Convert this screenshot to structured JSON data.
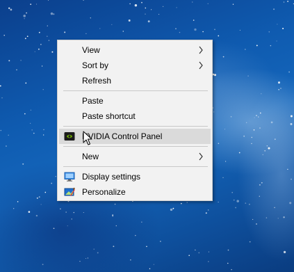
{
  "context_menu": {
    "items": [
      {
        "label": "View",
        "submenu": true
      },
      {
        "label": "Sort by",
        "submenu": true
      },
      {
        "label": "Refresh"
      },
      {
        "label": "Paste"
      },
      {
        "label": "Paste shortcut"
      },
      {
        "label": "NVIDIA Control Panel",
        "icon": "nvidia-icon",
        "highlighted": true
      },
      {
        "label": "New",
        "submenu": true
      },
      {
        "label": "Display settings",
        "icon": "display-icon"
      },
      {
        "label": "Personalize",
        "icon": "personalize-icon"
      }
    ]
  },
  "colors": {
    "menu_background": "#f2f2f2",
    "highlight": "#dadada",
    "nvidia_green": "#76b900",
    "desktop_blue": "#0f5bb0"
  }
}
